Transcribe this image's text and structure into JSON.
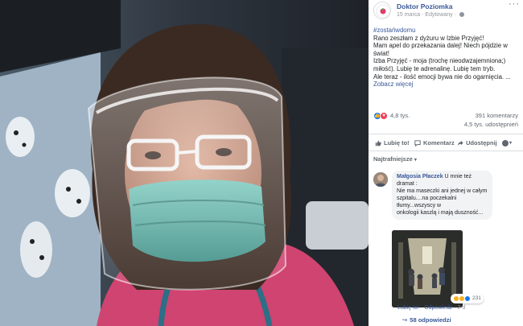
{
  "post": {
    "page_name": "Doktor Poziomka",
    "date": "15 marca",
    "edited": "Edytowany",
    "text_lines": [
      "#zostańwdomu",
      "Rano zeszłam z dyżuru w Izbie Przyjęć!",
      "Mam apel do przekazania dalej! Niech pójdzie w",
      "świat!",
      "Izba Przyjęć - moja (trochę nieodwzajemniona;)",
      "miłość). Lubię te adrenalinę. Lubię tem tryb.",
      "Ale teraz - ilość emocji bywa nie do ogarnięcia. ..."
    ],
    "see_more": "Zobacz więcej",
    "reaction_count": "4,8 tys.",
    "comments_count": "391 komentarzy",
    "shares_count": "4,5 tys. udostępnień"
  },
  "actions": {
    "like": "Lubię to!",
    "comment": "Komentarz",
    "share": "Udostępnij"
  },
  "sort_label": "Najtrafniejsze",
  "comment": {
    "author": "Małgosia Płaczek",
    "lines": [
      "U mnie też dramat :",
      "Nie ma maseczki ani jednej w całym",
      "szpitalu....na poczekalni tłumy...wszyscy w",
      "onkologii kaszlą i mają duszność..."
    ],
    "reaction_count": "231",
    "like_label": "Lubię to!",
    "reply_label": "Odpowiedz",
    "time": "2 d",
    "replies_label": "58 odpowiedzi"
  },
  "colors": {
    "link": "#385898",
    "like_blue": "#1877f2",
    "love_red": "#f33e58",
    "mask_teal": "#5fb3a8",
    "scrub_pink": "#d1476f"
  },
  "icons": [
    "like-icon",
    "love-icon",
    "comment-icon",
    "share-icon",
    "globe-icon",
    "more-icon",
    "reply-arrow-icon"
  ]
}
